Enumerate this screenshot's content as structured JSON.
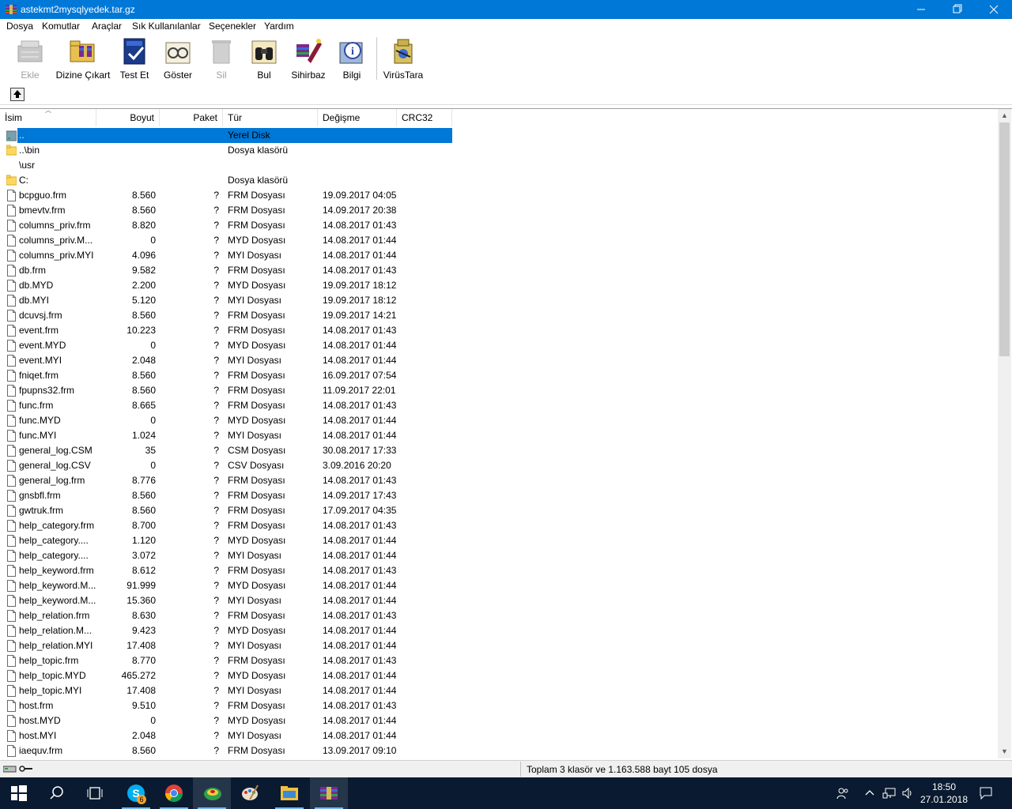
{
  "window": {
    "title": "astekmt2mysqlyedek.tar.gz"
  },
  "menu": [
    "Dosya",
    "Komutlar",
    "Araçlar",
    "Sık Kullanılanlar",
    "Seçenekler",
    "Yardım"
  ],
  "toolbar": [
    {
      "label": "Ekle",
      "icon": "add-archive-icon",
      "enabled": false
    },
    {
      "label": "Dizine Çıkart",
      "icon": "extract-folder-icon",
      "enabled": true
    },
    {
      "label": "Test Et",
      "icon": "test-book-icon",
      "enabled": true
    },
    {
      "label": "Göster",
      "icon": "view-glasses-icon",
      "enabled": true
    },
    {
      "label": "Sil",
      "icon": "delete-icon",
      "enabled": false
    },
    {
      "label": "Bul",
      "icon": "find-binoculars-icon",
      "enabled": true
    },
    {
      "label": "Sihirbaz",
      "icon": "wizard-icon",
      "enabled": true
    },
    {
      "label": "Bilgi",
      "icon": "info-icon",
      "enabled": true
    },
    {
      "label": "VirüsTara",
      "icon": "virus-scan-icon",
      "enabled": true
    }
  ],
  "columns": [
    "İsim",
    "Boyut",
    "Paket",
    "Tür",
    "Değişme",
    "CRC32"
  ],
  "rows": [
    {
      "name": "..",
      "size": "",
      "packed": "",
      "type": "Yerel Disk",
      "modified": "",
      "kind": "drive",
      "selected": true
    },
    {
      "name": "..\\bin",
      "size": "",
      "packed": "",
      "type": "Dosya klasörü",
      "modified": "",
      "kind": "folder"
    },
    {
      "name": "\\usr",
      "size": "",
      "packed": "",
      "type": "",
      "modified": "",
      "kind": "none"
    },
    {
      "name": "C:",
      "size": "",
      "packed": "",
      "type": "Dosya klasörü",
      "modified": "",
      "kind": "folder"
    },
    {
      "name": "bcpguo.frm",
      "size": "8.560",
      "packed": "?",
      "type": "FRM Dosyası",
      "modified": "19.09.2017 04:05",
      "kind": "file"
    },
    {
      "name": "bmevtv.frm",
      "size": "8.560",
      "packed": "?",
      "type": "FRM Dosyası",
      "modified": "14.09.2017 20:38",
      "kind": "file"
    },
    {
      "name": "columns_priv.frm",
      "size": "8.820",
      "packed": "?",
      "type": "FRM Dosyası",
      "modified": "14.08.2017 01:43",
      "kind": "file"
    },
    {
      "name": "columns_priv.M...",
      "size": "0",
      "packed": "?",
      "type": "MYD Dosyası",
      "modified": "14.08.2017 01:44",
      "kind": "file"
    },
    {
      "name": "columns_priv.MYI",
      "size": "4.096",
      "packed": "?",
      "type": "MYI Dosyası",
      "modified": "14.08.2017 01:44",
      "kind": "file"
    },
    {
      "name": "db.frm",
      "size": "9.582",
      "packed": "?",
      "type": "FRM Dosyası",
      "modified": "14.08.2017 01:43",
      "kind": "file"
    },
    {
      "name": "db.MYD",
      "size": "2.200",
      "packed": "?",
      "type": "MYD Dosyası",
      "modified": "19.09.2017 18:12",
      "kind": "file"
    },
    {
      "name": "db.MYI",
      "size": "5.120",
      "packed": "?",
      "type": "MYI Dosyası",
      "modified": "19.09.2017 18:12",
      "kind": "file"
    },
    {
      "name": "dcuvsj.frm",
      "size": "8.560",
      "packed": "?",
      "type": "FRM Dosyası",
      "modified": "19.09.2017 14:21",
      "kind": "file"
    },
    {
      "name": "event.frm",
      "size": "10.223",
      "packed": "?",
      "type": "FRM Dosyası",
      "modified": "14.08.2017 01:43",
      "kind": "file"
    },
    {
      "name": "event.MYD",
      "size": "0",
      "packed": "?",
      "type": "MYD Dosyası",
      "modified": "14.08.2017 01:44",
      "kind": "file"
    },
    {
      "name": "event.MYI",
      "size": "2.048",
      "packed": "?",
      "type": "MYI Dosyası",
      "modified": "14.08.2017 01:44",
      "kind": "file"
    },
    {
      "name": "fniqet.frm",
      "size": "8.560",
      "packed": "?",
      "type": "FRM Dosyası",
      "modified": "16.09.2017 07:54",
      "kind": "file"
    },
    {
      "name": "fpupns32.frm",
      "size": "8.560",
      "packed": "?",
      "type": "FRM Dosyası",
      "modified": "11.09.2017 22:01",
      "kind": "file"
    },
    {
      "name": "func.frm",
      "size": "8.665",
      "packed": "?",
      "type": "FRM Dosyası",
      "modified": "14.08.2017 01:43",
      "kind": "file"
    },
    {
      "name": "func.MYD",
      "size": "0",
      "packed": "?",
      "type": "MYD Dosyası",
      "modified": "14.08.2017 01:44",
      "kind": "file"
    },
    {
      "name": "func.MYI",
      "size": "1.024",
      "packed": "?",
      "type": "MYI Dosyası",
      "modified": "14.08.2017 01:44",
      "kind": "file"
    },
    {
      "name": "general_log.CSM",
      "size": "35",
      "packed": "?",
      "type": "CSM Dosyası",
      "modified": "30.08.2017 17:33",
      "kind": "file"
    },
    {
      "name": "general_log.CSV",
      "size": "0",
      "packed": "?",
      "type": "CSV Dosyası",
      "modified": "3.09.2016 20:20",
      "kind": "file"
    },
    {
      "name": "general_log.frm",
      "size": "8.776",
      "packed": "?",
      "type": "FRM Dosyası",
      "modified": "14.08.2017 01:43",
      "kind": "file"
    },
    {
      "name": "gnsbfl.frm",
      "size": "8.560",
      "packed": "?",
      "type": "FRM Dosyası",
      "modified": "14.09.2017 17:43",
      "kind": "file"
    },
    {
      "name": "gwtruk.frm",
      "size": "8.560",
      "packed": "?",
      "type": "FRM Dosyası",
      "modified": "17.09.2017 04:35",
      "kind": "file"
    },
    {
      "name": "help_category.frm",
      "size": "8.700",
      "packed": "?",
      "type": "FRM Dosyası",
      "modified": "14.08.2017 01:43",
      "kind": "file"
    },
    {
      "name": "help_category....",
      "size": "1.120",
      "packed": "?",
      "type": "MYD Dosyası",
      "modified": "14.08.2017 01:44",
      "kind": "file"
    },
    {
      "name": "help_category....",
      "size": "3.072",
      "packed": "?",
      "type": "MYI Dosyası",
      "modified": "14.08.2017 01:44",
      "kind": "file"
    },
    {
      "name": "help_keyword.frm",
      "size": "8.612",
      "packed": "?",
      "type": "FRM Dosyası",
      "modified": "14.08.2017 01:43",
      "kind": "file"
    },
    {
      "name": "help_keyword.M...",
      "size": "91.999",
      "packed": "?",
      "type": "MYD Dosyası",
      "modified": "14.08.2017 01:44",
      "kind": "file"
    },
    {
      "name": "help_keyword.M...",
      "size": "15.360",
      "packed": "?",
      "type": "MYI Dosyası",
      "modified": "14.08.2017 01:44",
      "kind": "file"
    },
    {
      "name": "help_relation.frm",
      "size": "8.630",
      "packed": "?",
      "type": "FRM Dosyası",
      "modified": "14.08.2017 01:43",
      "kind": "file"
    },
    {
      "name": "help_relation.M...",
      "size": "9.423",
      "packed": "?",
      "type": "MYD Dosyası",
      "modified": "14.08.2017 01:44",
      "kind": "file"
    },
    {
      "name": "help_relation.MYI",
      "size": "17.408",
      "packed": "?",
      "type": "MYI Dosyası",
      "modified": "14.08.2017 01:44",
      "kind": "file"
    },
    {
      "name": "help_topic.frm",
      "size": "8.770",
      "packed": "?",
      "type": "FRM Dosyası",
      "modified": "14.08.2017 01:43",
      "kind": "file"
    },
    {
      "name": "help_topic.MYD",
      "size": "465.272",
      "packed": "?",
      "type": "MYD Dosyası",
      "modified": "14.08.2017 01:44",
      "kind": "file"
    },
    {
      "name": "help_topic.MYI",
      "size": "17.408",
      "packed": "?",
      "type": "MYI Dosyası",
      "modified": "14.08.2017 01:44",
      "kind": "file"
    },
    {
      "name": "host.frm",
      "size": "9.510",
      "packed": "?",
      "type": "FRM Dosyası",
      "modified": "14.08.2017 01:43",
      "kind": "file"
    },
    {
      "name": "host.MYD",
      "size": "0",
      "packed": "?",
      "type": "MYD Dosyası",
      "modified": "14.08.2017 01:44",
      "kind": "file"
    },
    {
      "name": "host.MYI",
      "size": "2.048",
      "packed": "?",
      "type": "MYI Dosyası",
      "modified": "14.08.2017 01:44",
      "kind": "file"
    },
    {
      "name": "iaequv.frm",
      "size": "8.560",
      "packed": "?",
      "type": "FRM Dosyası",
      "modified": "13.09.2017 09:10",
      "kind": "file"
    }
  ],
  "status": {
    "text": "Toplam 3 klasör ve 1.163.588 bayt 105 dosya"
  },
  "taskbar": {
    "skype_badge": "6",
    "time": "18:50",
    "date": "27.01.2018"
  },
  "colors": {
    "accent": "#0078d7",
    "taskbar": "#0a1a30",
    "folder": "#ffd75e"
  }
}
